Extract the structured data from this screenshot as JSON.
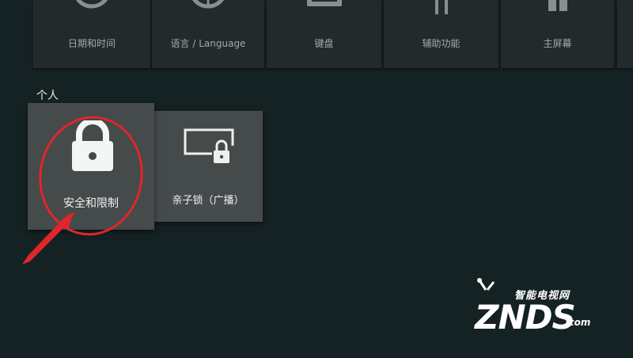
{
  "top_row": [
    {
      "label": "日期和时间",
      "icon": "clock-icon"
    },
    {
      "label": "语言 / Language",
      "icon": "globe-icon"
    },
    {
      "label": "键盘",
      "icon": "keyboard-icon"
    },
    {
      "label": "辅助功能",
      "icon": "accessibility-icon"
    },
    {
      "label": "主屏幕",
      "icon": "home-screen-icon"
    }
  ],
  "section": {
    "title": "个人"
  },
  "personal_items": [
    {
      "label": "安全和限制",
      "icon": "lock-icon",
      "focused": true
    },
    {
      "label": "亲子锁（广播）",
      "icon": "screen-lock-icon",
      "focused": false
    }
  ],
  "watermark": {
    "tagline": "智能电视网",
    "brand": "ZNDS",
    "suffix": ".com"
  },
  "colors": {
    "background": "#152224",
    "card": "#454a4a",
    "top_card": "#232a2b",
    "annotation": "#e0262a"
  }
}
